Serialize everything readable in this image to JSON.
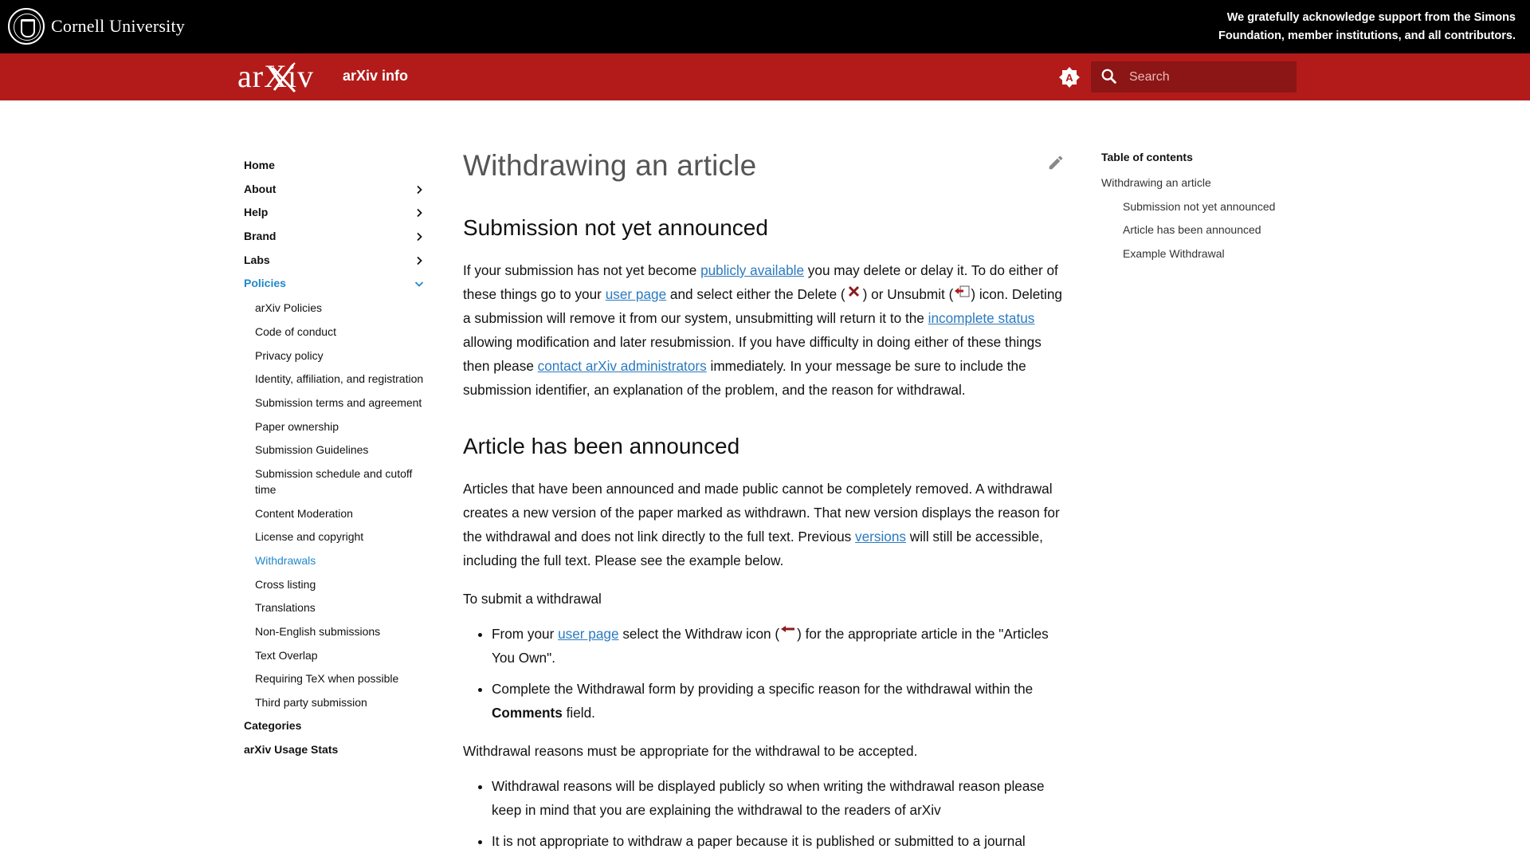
{
  "top_banner": {
    "institution": "Cornell University",
    "acknowledgement": "We gratefully acknowledge support from the Simons Foundation, member institutions, and all contributors."
  },
  "header": {
    "logo_text": "arXiv",
    "site_title": "arXiv info",
    "search_placeholder": "Search",
    "colors": {
      "brand_red": "#b31b1b",
      "search_bg": "#8c1515",
      "banner": "#000000"
    }
  },
  "nav": {
    "items": [
      {
        "label": "Home",
        "has_children": false
      },
      {
        "label": "About",
        "has_children": true
      },
      {
        "label": "Help",
        "has_children": true
      },
      {
        "label": "Brand",
        "has_children": true
      },
      {
        "label": "Labs",
        "has_children": true
      },
      {
        "label": "Policies",
        "has_children": true,
        "expanded": true,
        "active": true
      }
    ],
    "policies_children": [
      "arXiv Policies",
      "Code of conduct",
      "Privacy policy",
      "Identity, affiliation, and registration",
      "Submission terms and agreement",
      "Paper ownership",
      "Submission Guidelines",
      "Submission schedule and cutoff time",
      "Content Moderation",
      "License and copyright",
      "Withdrawals",
      "Cross listing",
      "Translations",
      "Non-English submissions",
      "Text Overlap",
      "Requiring TeX when possible",
      "Third party submission"
    ],
    "active_child": "Withdrawals",
    "bottom_items": [
      "Categories",
      "arXiv Usage Stats"
    ],
    "active_color": "#2188c9"
  },
  "content": {
    "title": "Withdrawing an article",
    "section1": {
      "heading": "Submission not yet announced",
      "t1": "If your submission has not yet become ",
      "l1": "publicly available",
      "t2": " you may delete or delay it. To do either of these things go to your ",
      "l2": "user page",
      "t3": " and select either the Delete (",
      "t4": ") or Unsubmit (",
      "t5": ") icon. Deleting a submission will remove it from our system, unsubmitting will return it to the ",
      "l3": "incomplete status",
      "t6": " allowing modification and later resubmission. If you have difficulty in doing either of these things then please ",
      "l4": "contact arXiv administrators",
      "t7": " immediately. In your message be sure to include the submission identifier, an explanation of the problem, and the reason for withdrawal."
    },
    "section2": {
      "heading": "Article has been announced",
      "p1a": "Articles that have been announced and made public cannot be completely removed. A withdrawal creates a new version of the paper marked as withdrawn. That new version displays the reason for the withdrawal and does not link directly to the full text. Previous ",
      "p1_link": "versions",
      "p1b": " will still be accessible, including the full text. Please see the example below.",
      "p2": "To submit a withdrawal",
      "b1a": "From your ",
      "b1_link": "user page",
      "b1b": " select the Withdraw icon (",
      "b1c": ") for the appropriate article in the \"Articles You Own\".",
      "b2a": "Complete the Withdrawal form by providing a specific reason for the withdrawal within the ",
      "b2_bold": "Comments",
      "b2b": " field.",
      "p3": "Withdrawal reasons must be appropriate for the withdrawal to be accepted.",
      "b3": "Withdrawal reasons will be displayed publicly so when writing the withdrawal reason please keep in mind that you are explaining the withdrawal to the readers of arXiv",
      "b4": "It is not appropriate to withdraw a paper because it is published or submitted to a journal"
    },
    "link_color": "#2a7ac0"
  },
  "toc": {
    "title": "Table of contents",
    "items": [
      {
        "label": "Withdrawing an article",
        "level": 1
      },
      {
        "label": "Submission not yet announced",
        "level": 2
      },
      {
        "label": "Article has been announced",
        "level": 2
      },
      {
        "label": "Example Withdrawal",
        "level": 2
      }
    ]
  }
}
